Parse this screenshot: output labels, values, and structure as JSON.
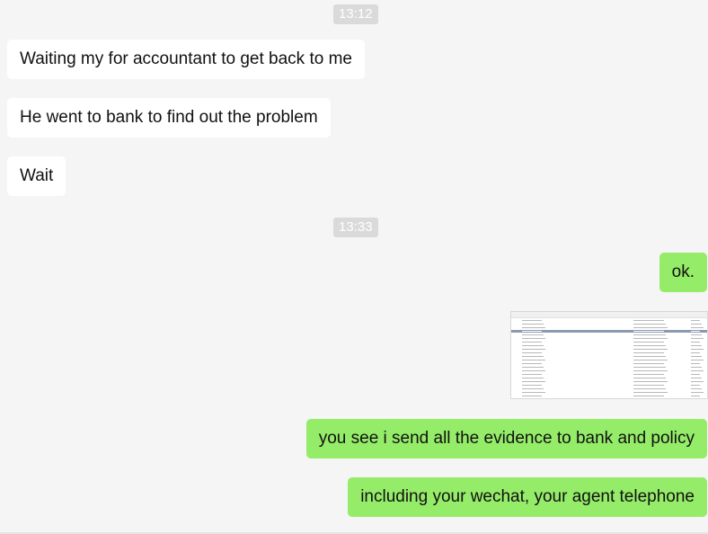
{
  "timestamps": [
    "13:12",
    "13:33"
  ],
  "messages": [
    {
      "side": "in",
      "text": "Waiting my for accountant to  get back to me"
    },
    {
      "side": "in",
      "text": "He went to bank to find out the problem"
    },
    {
      "side": "in",
      "text": "Wait"
    },
    {
      "side": "out",
      "text": "ok."
    },
    {
      "side": "out",
      "type": "image",
      "description_icon": "spreadsheet-thumbnail"
    },
    {
      "side": "out",
      "text": "you see i send all the evidence to bank and policy"
    },
    {
      "side": "out",
      "text": "including your wechat, your agent telephone"
    }
  ],
  "colors": {
    "background": "#f5f5f5",
    "incoming_bubble": "#ffffff",
    "outgoing_bubble": "#95ec69",
    "timestamp_bg": "#dadada"
  }
}
